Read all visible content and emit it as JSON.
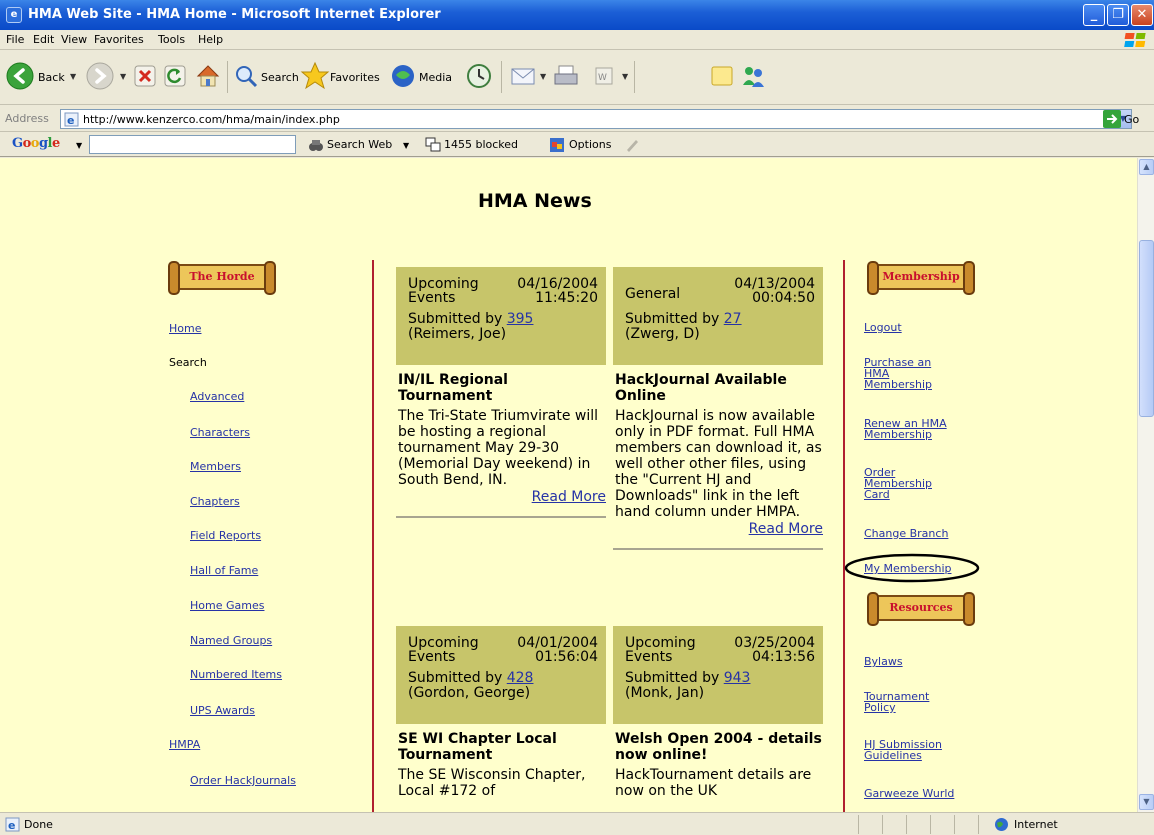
{
  "window": {
    "title": "HMA Web Site - HMA Home - Microsoft Internet Explorer"
  },
  "menu": [
    "File",
    "Edit",
    "View",
    "Favorites",
    "Tools",
    "Help"
  ],
  "toolbar": {
    "back": "Back",
    "search": "Search",
    "favorites": "Favorites",
    "media": "Media"
  },
  "address": {
    "label": "Address",
    "url": "http://www.kenzerco.com/hma/main/index.php",
    "go": "Go"
  },
  "google": {
    "logo": "Google",
    "search_web": "Search Web",
    "blocked": "1455 blocked",
    "options": "Options"
  },
  "page": {
    "title": "HMA News"
  },
  "left_nav": {
    "banner": "The Horde",
    "home": "Home",
    "search": "Search",
    "items": [
      "Advanced",
      "Characters",
      "Members",
      "Chapters",
      "Field Reports",
      "Hall of Fame",
      "Home Games",
      "Named Groups",
      "Numbered Items",
      "UPS Awards"
    ],
    "hmpa": "HMPA",
    "order": "Order HackJournals"
  },
  "right_nav": {
    "membership_banner": "Membership",
    "membership_links": [
      "Logout",
      "Purchase an HMA Membership",
      "Renew an HMA Membership",
      "Order Membership Card",
      "Change Branch",
      "My Membership"
    ],
    "resources_banner": "Resources",
    "resource_links": [
      "Bylaws",
      "Tournament Policy",
      "HJ Submission Guidelines",
      "Garweeze Wurld"
    ]
  },
  "news": [
    {
      "category": "Upcoming\nEvents",
      "datetime": "04/16/2004\n11:45:20",
      "submitted_prefix": "Submitted by",
      "submitter_id": "395",
      "submitter_name": "(Reimers, Joe)",
      "title": "IN/IL Regional Tournament",
      "body": "The Tri-State Triumvirate will be hosting a regional tournament May 29-30 (Memorial Day weekend) in South Bend, IN.",
      "more": "Read More"
    },
    {
      "category": "General",
      "datetime": "04/13/2004\n00:04:50",
      "submitted_prefix": "Submitted by",
      "submitter_id": "27",
      "submitter_name": "(Zwerg, D)",
      "title": "HackJournal Available Online",
      "body": "HackJournal is now available only in PDF format. Full HMA members can download it, as well other other files, using the \"Current HJ and Downloads\" link in the left hand column under HMPA.",
      "more": "Read More"
    },
    {
      "category": "Upcoming\nEvents",
      "datetime": "04/01/2004\n01:56:04",
      "submitted_prefix": "Submitted by",
      "submitter_id": "428",
      "submitter_name": "(Gordon, George)",
      "title": "SE WI Chapter Local Tournament",
      "body": "The SE Wisconsin Chapter, Local #172 of",
      "more": ""
    },
    {
      "category": "Upcoming\nEvents",
      "datetime": "03/25/2004\n04:13:56",
      "submitted_prefix": "Submitted by",
      "submitter_id": "943",
      "submitter_name": "(Monk, Jan)",
      "title": "Welsh Open 2004 - details now online!",
      "body": "HackTournament details are now on the UK",
      "more": ""
    }
  ],
  "status": {
    "text": "Done",
    "zone": "Internet"
  },
  "colors": {
    "page_bg": "#FFFFCC",
    "news_header": "#C7C56A",
    "link": "#2633A6",
    "rule": "#B02030",
    "banner_text": "#C8102E"
  }
}
